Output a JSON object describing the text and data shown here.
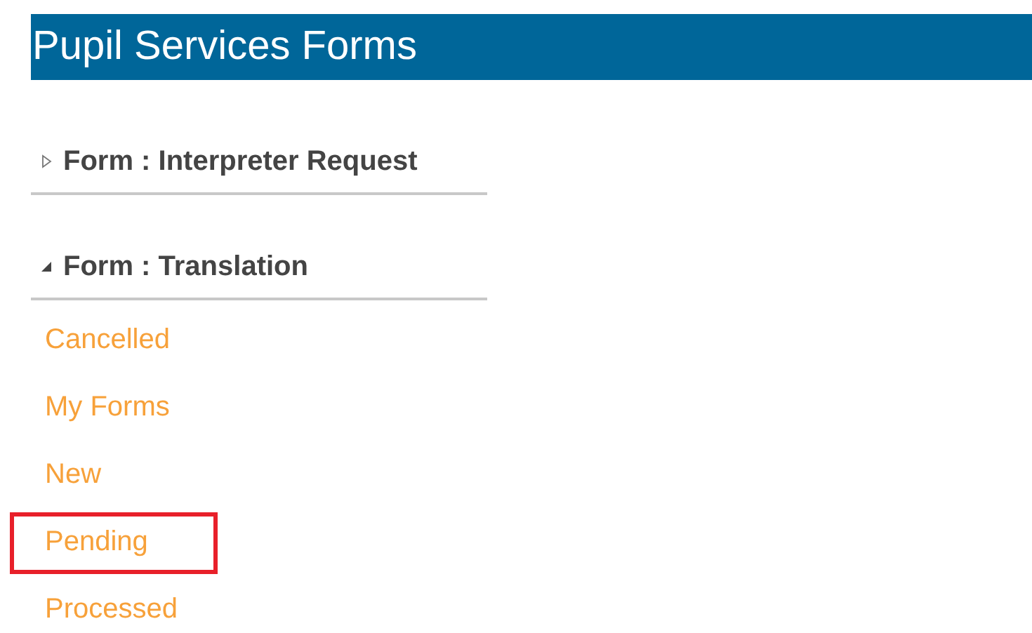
{
  "title": "Pupil Services Forms",
  "groups": [
    {
      "label": "Form : Interpreter Request",
      "expanded": false
    },
    {
      "label": "Form : Translation",
      "expanded": true,
      "items": [
        {
          "label": "Cancelled",
          "highlighted": false
        },
        {
          "label": "My Forms",
          "highlighted": false
        },
        {
          "label": "New",
          "highlighted": false
        },
        {
          "label": "Pending",
          "highlighted": true
        },
        {
          "label": "Processed",
          "highlighted": false
        }
      ]
    }
  ]
}
